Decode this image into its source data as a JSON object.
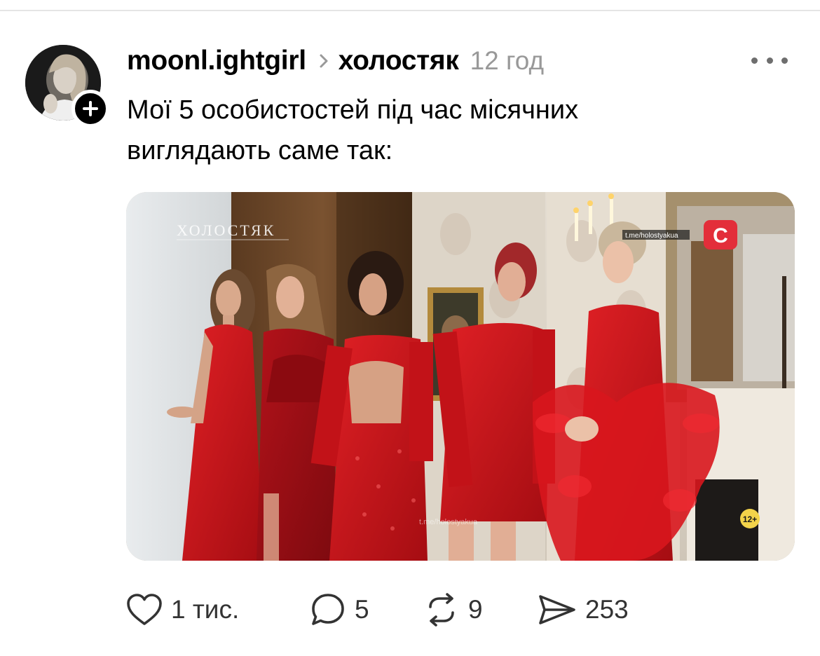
{
  "post": {
    "username": "moonl.ightgirl",
    "topic": "холостяк",
    "time": "12 год",
    "text_lines": [
      "Мої 5 особистостей під час місячних",
      "виглядають саме так:"
    ],
    "media": {
      "show_logo": "ХОЛОСТЯК",
      "channel_watermark": "t.me/holostyakua",
      "age_rating": "12+",
      "channel_badge": "C"
    }
  },
  "actions": {
    "likes": "1 тис.",
    "comments": "5",
    "reposts": "9",
    "shares": "253"
  },
  "icons": {
    "like": "heart-icon",
    "comment": "comment-bubble-icon",
    "repost": "repost-icon",
    "share": "send-icon",
    "more": "more-dots-icon",
    "follow": "plus-icon",
    "separator": "chevron-right-icon"
  },
  "colors": {
    "text": "#000000",
    "muted": "#999999",
    "icon": "#333333",
    "dress_red": "#c8141a"
  }
}
